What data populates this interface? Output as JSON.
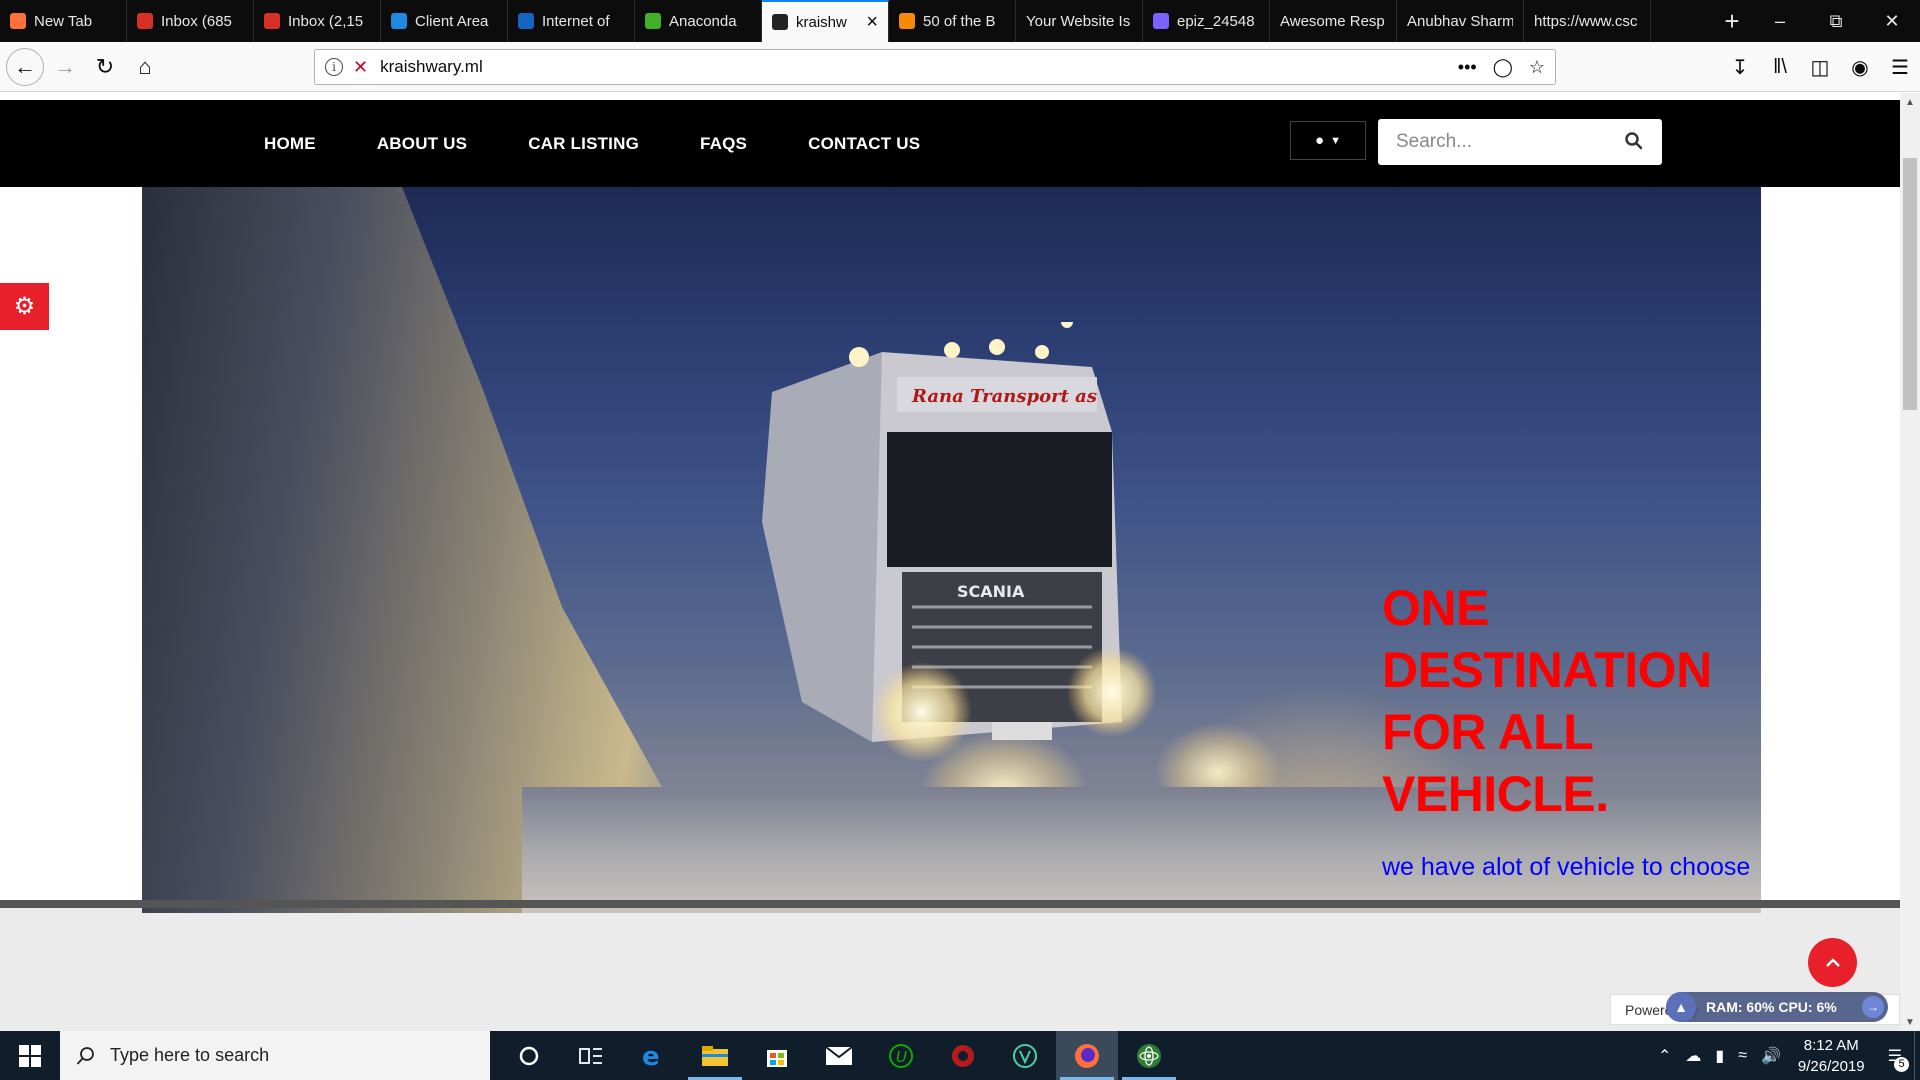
{
  "browser": {
    "tabs": [
      {
        "label": "New Tab",
        "icon": "firefox-icon",
        "color": "#ff7139"
      },
      {
        "label": "Inbox (685",
        "icon": "gmail-icon",
        "color": "#d93025"
      },
      {
        "label": "Inbox (2,15",
        "icon": "gmail-icon",
        "color": "#d93025"
      },
      {
        "label": "Client Area",
        "icon": "n-logo-icon",
        "color": "#1e88e5"
      },
      {
        "label": "Internet of",
        "icon": "s-logo-icon",
        "color": "#1565c0"
      },
      {
        "label": "Anaconda",
        "icon": "anaconda-icon",
        "color": "#43b02a"
      },
      {
        "label": "kraishw",
        "icon": "site-icon",
        "color": "#222222"
      },
      {
        "label": "50 of the B",
        "icon": "bookmark-icon",
        "color": "#f58a07"
      },
      {
        "label": "Your Website Is",
        "icon": "",
        "color": ""
      },
      {
        "label": "epiz_24548",
        "icon": "infinity-icon",
        "color": "#7b61ff"
      },
      {
        "label": "Awesome Resp",
        "icon": "",
        "color": ""
      },
      {
        "label": "Anubhav Sharm",
        "icon": "",
        "color": ""
      },
      {
        "label": "https://www.csc",
        "icon": "",
        "color": ""
      }
    ],
    "active_tab_index": 6,
    "url": "kraishwary.ml"
  },
  "site": {
    "menu": [
      "HOME",
      "ABOUT US",
      "CAR LISTING",
      "FAQS",
      "CONTACT US"
    ],
    "search_placeholder": "Search...",
    "hero_title": "ONE DESTINATION FOR ALL VEHICLE.",
    "hero_subtitle": "we have alot of vehicle to choose",
    "truck_brand": "SCANIA",
    "truck_banner": "Rana Transport as",
    "powered_by": "Powered by",
    "sysmon": "RAM: 60%   CPU: 6%",
    "accent_color": "#e8202b"
  },
  "taskbar": {
    "search_placeholder": "Type here to search",
    "time": "8:12 AM",
    "date": "9/26/2019",
    "notifications": "5"
  }
}
